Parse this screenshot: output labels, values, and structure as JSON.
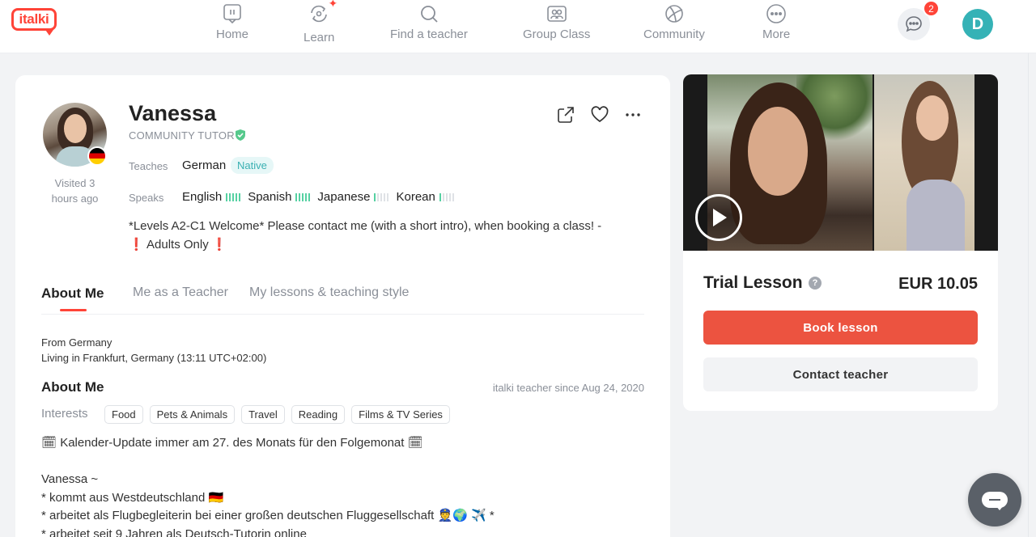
{
  "logo": {
    "text": "italki"
  },
  "nav": {
    "items": [
      {
        "label": "Home",
        "icon": "home-icon"
      },
      {
        "label": "Learn",
        "icon": "learn-icon"
      },
      {
        "label": "Find a teacher",
        "icon": "search-icon"
      },
      {
        "label": "Group Class",
        "icon": "group-class-icon"
      },
      {
        "label": "Community",
        "icon": "community-icon"
      },
      {
        "label": "More",
        "icon": "more-icon"
      }
    ],
    "message_count": "2",
    "user_initial": "D"
  },
  "profile": {
    "name": "Vanessa",
    "tutor_type": "COMMUNITY TUTOR",
    "visited": "Visited 3 hours ago",
    "teaches_label": "Teaches",
    "teaches_language": "German",
    "native_badge": "Native",
    "speaks_label": "Speaks",
    "speaks": [
      {
        "language": "English",
        "level": 5
      },
      {
        "language": "Spanish",
        "level": 5
      },
      {
        "language": "Japanese",
        "level": 1
      },
      {
        "language": "Korean",
        "level": 1
      }
    ],
    "bio_line1": "*Levels A2-C1 Welcome* Please contact me (with a short intro), when booking a class! -",
    "bio_line2": "Adults Only",
    "bio_mark": "❗"
  },
  "tabs": [
    {
      "label": "About Me",
      "active": true
    },
    {
      "label": "Me as a Teacher",
      "active": false
    },
    {
      "label": "My lessons & teaching style",
      "active": false
    }
  ],
  "about": {
    "from": "From Germany",
    "living": "Living in Frankfurt, Germany (13:11 UTC+02:00)",
    "heading": "About Me",
    "since": "italki teacher since Aug 24, 2020",
    "interests_label": "Interests",
    "interests": [
      "Food",
      "Pets & Animals",
      "Travel",
      "Reading",
      "Films & TV Series"
    ],
    "description": "🗓 Kalender-Update immer am 27. des Monats für den Folgemonat 🗓\n\nVanessa ~\n* kommt aus Westdeutschland 🇩🇪\n* arbeitet als Flugbegleiterin bei einer großen deutschen Fluggesellschaft 👮🌍 ✈️ *\n* arbeitet seit 9 Jahren als Deutsch-Tutorin online"
  },
  "booking": {
    "trial_label": "Trial Lesson",
    "help_mark": "?",
    "price": "EUR 10.05",
    "book_label": "Book lesson",
    "contact_label": "Contact teacher"
  },
  "colors": {
    "brand": "#ff4438",
    "book_button": "#ec5340",
    "native_badge": "#3ab0b2",
    "level_bar": "#56d1a2",
    "avatar": "#35b2b6"
  }
}
